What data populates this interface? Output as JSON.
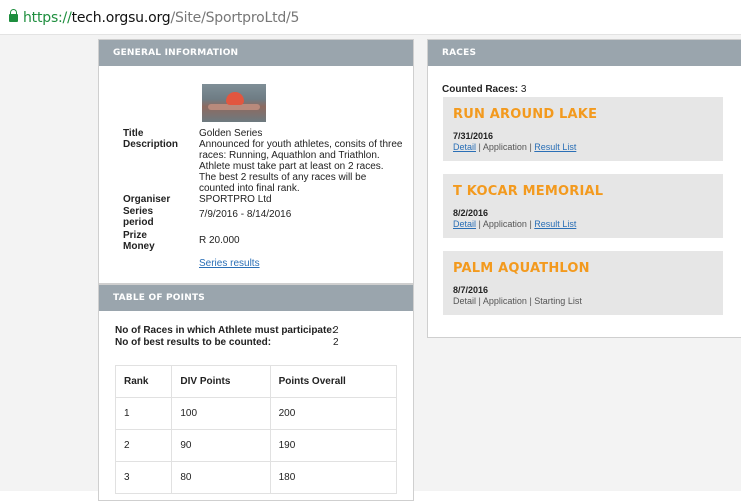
{
  "browser": {
    "url_scheme": "https://",
    "url_host": "tech.orgsu.org",
    "url_path": "/Site/SportproLtd/5"
  },
  "general": {
    "title": "GENERAL INFORMATION",
    "fields": {
      "title_label": "Title",
      "title_value": "Golden Series",
      "description_label": "Description",
      "description_value": "Announced for youth athletes, consits of three races: Running, Aquathlon and Triathlon. Athlete must take part at least on 2 races. The best 2 results of any races will be counted into final rank.",
      "organiser_label": "Organiser",
      "organiser_value": "SPORTPRO Ltd",
      "series_period_label": "Series period",
      "series_period_value": "7/9/2016 - 8/14/2016",
      "prize_money_label": "Prize Money",
      "prize_money_value": "R 20.000",
      "series_results_link": "Series results"
    }
  },
  "points": {
    "title": "TABLE OF POINTS",
    "races_label": "No of Races in which Athlete must participate:",
    "races_value": "2",
    "best_label": "No of best results to be counted:",
    "best_value": "2",
    "columns": [
      "Rank",
      "DIV Points",
      "Points Overall"
    ],
    "rows": [
      [
        "1",
        "100",
        "200"
      ],
      [
        "2",
        "90",
        "190"
      ],
      [
        "3",
        "80",
        "180"
      ]
    ]
  },
  "races": {
    "title": "RACES",
    "counted_label": "Counted Races:",
    "counted_value": "3",
    "items": [
      {
        "name": "RUN AROUND LAKE",
        "date": "7/31/2016",
        "detail": "Detail",
        "sep": "|",
        "application": "Application",
        "list": "Result List"
      },
      {
        "name": "T KOCAR MEMORIAL",
        "date": "8/2/2016",
        "detail": "Detail",
        "sep": "|",
        "application": "Application",
        "list": "Result List"
      },
      {
        "name": "PALM AQUATHLON",
        "date": "8/7/2016",
        "detail": "Detail",
        "sep": "|",
        "application": "Application",
        "list": "Starting List"
      }
    ]
  },
  "colors": {
    "accent": "#f39a1e",
    "header": "#9aa5ad",
    "link": "#2a6fb6"
  }
}
